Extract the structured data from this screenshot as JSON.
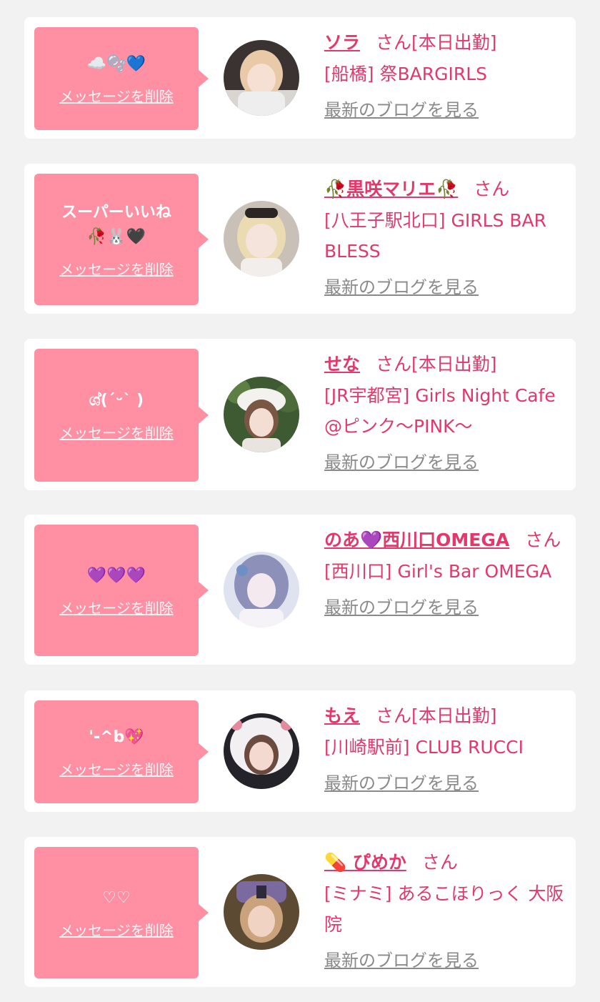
{
  "colors": {
    "background": "#f2f2f2",
    "card": "#ffffff",
    "bubble": "#ff8fa3",
    "accent": "#e4376a",
    "link_gray": "#8a8a8a"
  },
  "cards": [
    {
      "message": "☁️🫧💙",
      "delete_label": "メッセージを削除",
      "name": "ソラ",
      "suffix": "さん[本日出勤]",
      "shop": "[船橋] 祭BARGIRLS",
      "blog_label": "最新のブログを見る",
      "avatar_icon": "avatar-photo-sora"
    },
    {
      "message": "スーパーいいね\n🥀🐰🖤",
      "delete_label": "メッセージを削除",
      "name": "🥀黒咲マリエ🥀",
      "suffix": "さん",
      "shop": "[八王子駅北口] GIRLS BAR BLESS",
      "blog_label": "最新のブログを見る",
      "avatar_icon": "avatar-photo-marie"
    },
    {
      "message": "ශ්(ˊᵕˋ )",
      "delete_label": "メッセージを削除",
      "name": "せな",
      "suffix": "さん[本日出勤]",
      "shop": "[JR宇都宮] Girls Night Cafe @ピンク〜PINK〜",
      "blog_label": "最新のブログを見る",
      "avatar_icon": "avatar-photo-sena"
    },
    {
      "message": "💜💜💜",
      "delete_label": "メッセージを削除",
      "name": "のあ💜西川口OMEGA",
      "suffix": "さん",
      "shop": "[西川口] Girl's Bar OMEGA",
      "blog_label": "最新のブログを見る",
      "avatar_icon": "avatar-illustration-noa"
    },
    {
      "message": "'-^b💖",
      "delete_label": "メッセージを削除",
      "name": "もえ",
      "suffix": "さん[本日出勤]",
      "shop": "[川崎駅前] CLUB RUCCI",
      "blog_label": "最新のブログを見る",
      "avatar_icon": "avatar-photo-moe"
    },
    {
      "message": "♡♡",
      "delete_label": "メッセージを削除",
      "name": "💊 ぴめか",
      "suffix": "さん",
      "shop": "[ミナミ] あるこほりっく 大阪院",
      "blog_label": "最新のブログを見る",
      "avatar_icon": "avatar-photo-pimeka"
    }
  ]
}
